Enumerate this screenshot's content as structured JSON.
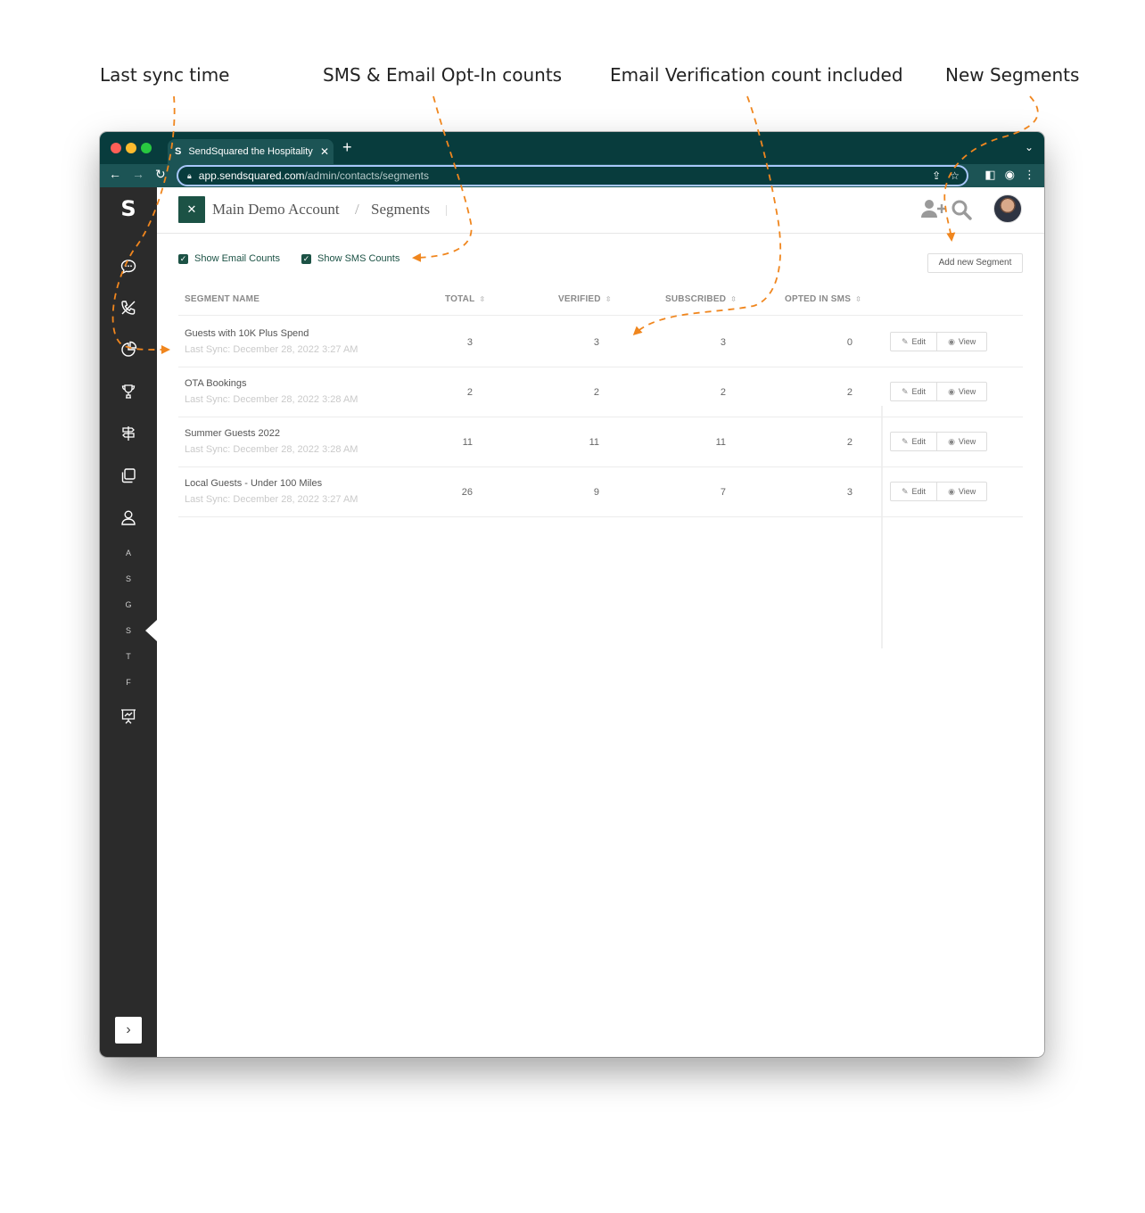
{
  "annotations": {
    "last_sync": "Last sync time",
    "counts": "SMS & Email Opt-In counts",
    "verification": "Email Verification count included",
    "new_segments": "New Segments"
  },
  "browser": {
    "tab_title": "SendSquared the Hospitality M",
    "tab_favicon": "S",
    "url_host": "app.sendsquared.com",
    "url_path": "/admin/contacts/segments"
  },
  "sidebar": {
    "logo": "S",
    "icons": [
      "chat-icon",
      "phone-icon",
      "pie-chart-icon",
      "trophy-icon",
      "signpost-icon",
      "copy-icon",
      "user-icon",
      "presentation-icon"
    ],
    "letters": [
      "A",
      "S",
      "G",
      "S",
      "T",
      "F"
    ],
    "active_letter_index": 3
  },
  "header": {
    "account": "Main Demo Account",
    "separator": "/",
    "page": "Segments"
  },
  "filters": {
    "show_email_counts": "Show Email Counts",
    "show_sms_counts": "Show SMS Counts",
    "email_checked": true,
    "sms_checked": true
  },
  "add_button": "Add new Segment",
  "table": {
    "columns": {
      "name": "SEGMENT NAME",
      "total": "TOTAL",
      "verified": "VERIFIED",
      "subscribed": "SUBSCRIBED",
      "opted": "OPTED IN SMS"
    },
    "edit_label": "Edit",
    "view_label": "View",
    "rows": [
      {
        "name": "Guests with 10K Plus Spend",
        "sync": "Last Sync: December 28, 2022 3:27 AM",
        "total": "3",
        "verified": "3",
        "subscribed": "3",
        "opted": "0"
      },
      {
        "name": "OTA Bookings",
        "sync": "Last Sync: December 28, 2022 3:28 AM",
        "total": "2",
        "verified": "2",
        "subscribed": "2",
        "opted": "2"
      },
      {
        "name": "Summer Guests 2022",
        "sync": "Last Sync: December 28, 2022 3:28 AM",
        "total": "11",
        "verified": "11",
        "subscribed": "11",
        "opted": "2"
      },
      {
        "name": "Local Guests - Under 100 Miles",
        "sync": "Last Sync: December 28, 2022 3:27 AM",
        "total": "26",
        "verified": "9",
        "subscribed": "7",
        "opted": "3"
      }
    ]
  },
  "colors": {
    "brand_dark": "#083c3d",
    "brand_green": "#1c5245",
    "annotation_arrow": "#f0861e",
    "sidebar": "#2b2b2b"
  }
}
